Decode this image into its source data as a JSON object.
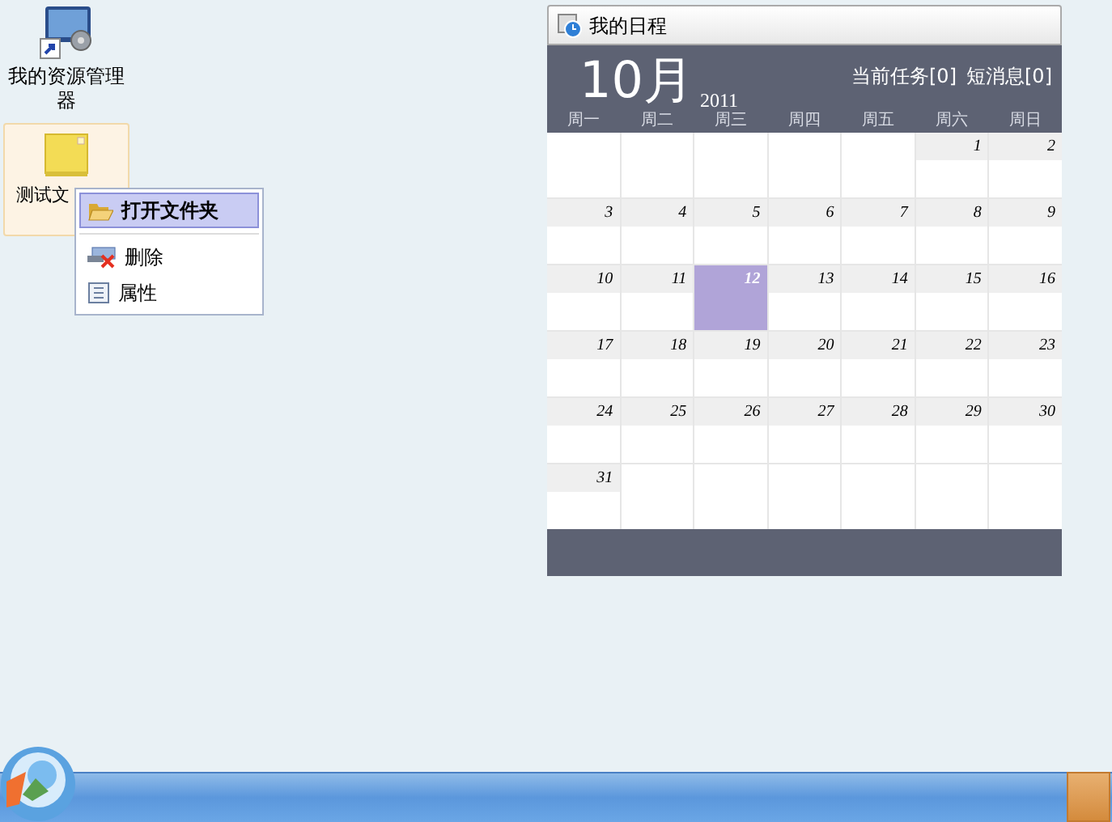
{
  "desktop_icons": [
    {
      "label": "我的资源管理器",
      "kind": "explorer",
      "selected": false
    },
    {
      "label": "测试文",
      "kind": "folder",
      "selected": true
    }
  ],
  "context_menu": {
    "items": [
      {
        "label": "打开文件夹",
        "kind": "open",
        "selected": true
      },
      {
        "label": "删除",
        "kind": "delete",
        "selected": false
      },
      {
        "label": "属性",
        "kind": "properties",
        "selected": false
      }
    ]
  },
  "calendar": {
    "title": "我的日程",
    "month": "10月",
    "year": "2011",
    "tasks": "当前任务[0]",
    "messages": "短消息[0]",
    "weekdays": [
      "周一",
      "周二",
      "周三",
      "周四",
      "周五",
      "周六",
      "周日"
    ],
    "weeks": [
      [
        {
          "kind": "blank"
        },
        {
          "kind": "blank"
        },
        {
          "kind": "blank"
        },
        {
          "kind": "blank"
        },
        {
          "kind": "blank"
        },
        {
          "kind": "day",
          "day": "1",
          "selected": false
        },
        {
          "kind": "day",
          "day": "2",
          "selected": false
        }
      ],
      [
        {
          "kind": "day",
          "day": "3",
          "selected": false
        },
        {
          "kind": "day",
          "day": "4",
          "selected": false
        },
        {
          "kind": "day",
          "day": "5",
          "selected": false
        },
        {
          "kind": "day",
          "day": "6",
          "selected": false
        },
        {
          "kind": "day",
          "day": "7",
          "selected": false
        },
        {
          "kind": "day",
          "day": "8",
          "selected": false
        },
        {
          "kind": "day",
          "day": "9",
          "selected": false
        }
      ],
      [
        {
          "kind": "day",
          "day": "10",
          "selected": false
        },
        {
          "kind": "day",
          "day": "11",
          "selected": false
        },
        {
          "kind": "day",
          "day": "12",
          "selected": true
        },
        {
          "kind": "day",
          "day": "13",
          "selected": false
        },
        {
          "kind": "day",
          "day": "14",
          "selected": false
        },
        {
          "kind": "day",
          "day": "15",
          "selected": false
        },
        {
          "kind": "day",
          "day": "16",
          "selected": false
        }
      ],
      [
        {
          "kind": "day",
          "day": "17",
          "selected": false
        },
        {
          "kind": "day",
          "day": "18",
          "selected": false
        },
        {
          "kind": "day",
          "day": "19",
          "selected": false
        },
        {
          "kind": "day",
          "day": "20",
          "selected": false
        },
        {
          "kind": "day",
          "day": "21",
          "selected": false
        },
        {
          "kind": "day",
          "day": "22",
          "selected": false
        },
        {
          "kind": "day",
          "day": "23",
          "selected": false
        }
      ],
      [
        {
          "kind": "day",
          "day": "24",
          "selected": false
        },
        {
          "kind": "day",
          "day": "25",
          "selected": false
        },
        {
          "kind": "day",
          "day": "26",
          "selected": false
        },
        {
          "kind": "day",
          "day": "27",
          "selected": false
        },
        {
          "kind": "day",
          "day": "28",
          "selected": false
        },
        {
          "kind": "day",
          "day": "29",
          "selected": false
        },
        {
          "kind": "day",
          "day": "30",
          "selected": false
        }
      ],
      [
        {
          "kind": "day",
          "day": "31",
          "selected": false
        },
        {
          "kind": "blank"
        },
        {
          "kind": "blank"
        },
        {
          "kind": "blank"
        },
        {
          "kind": "blank"
        },
        {
          "kind": "blank"
        },
        {
          "kind": "blank"
        }
      ]
    ]
  }
}
